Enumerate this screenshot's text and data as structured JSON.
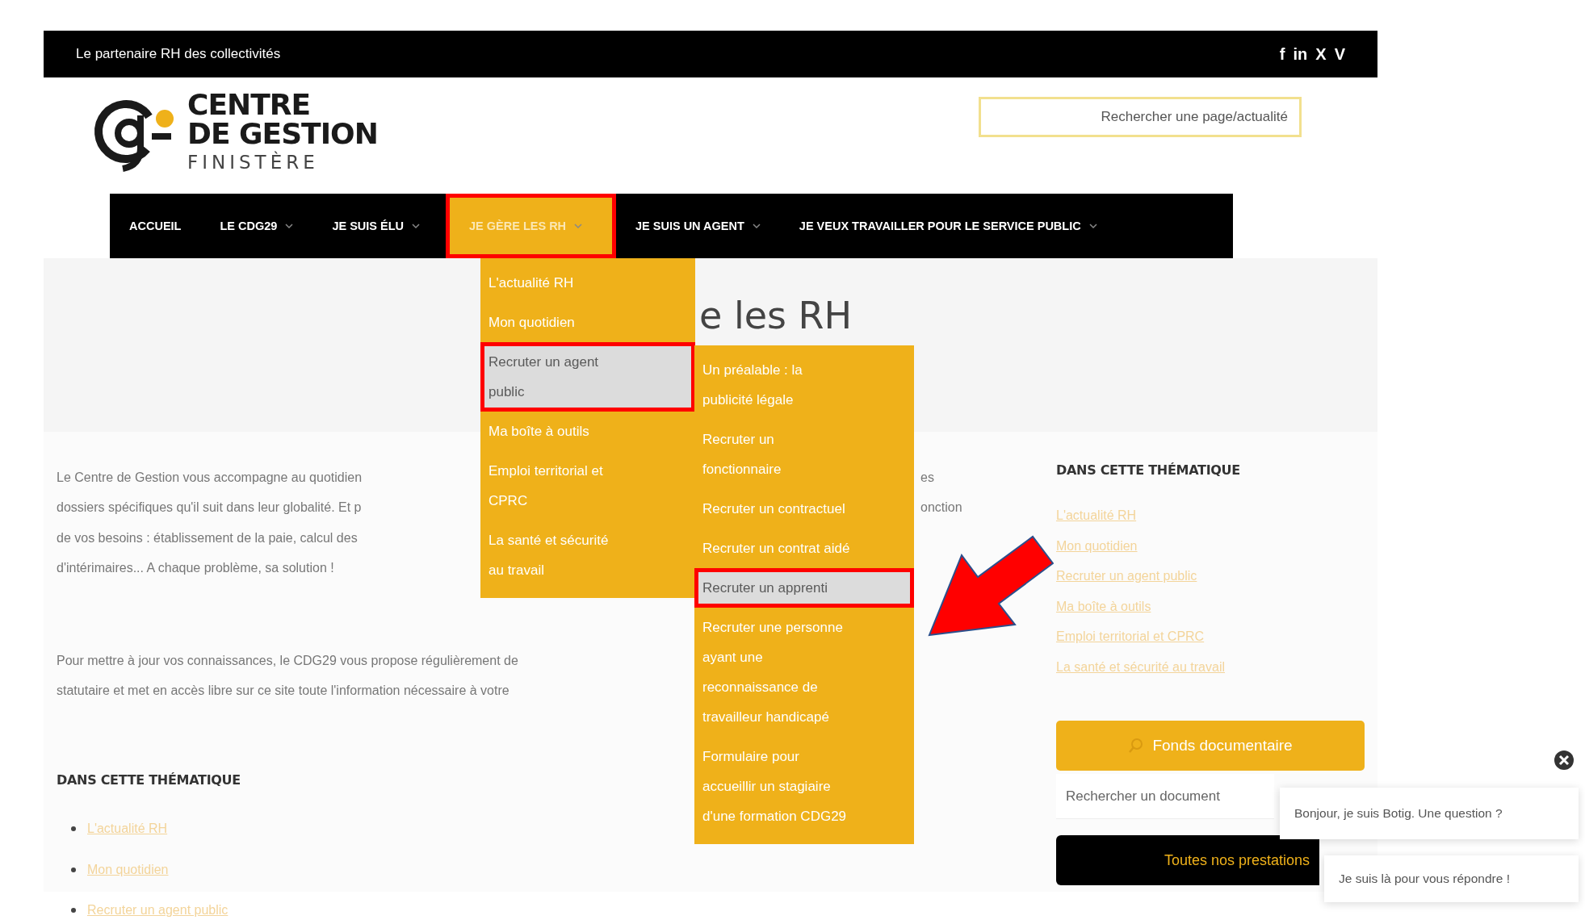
{
  "top_bar": {
    "tagline": "Le partenaire RH des collectivités",
    "social_links": [
      "f",
      "in",
      "X",
      "V"
    ]
  },
  "logo": {
    "line_1": "CENTRE",
    "line_2": "DE GESTION",
    "line_3": "FINISTÈRE"
  },
  "search": {
    "placeholder": "Rechercher une page/actualité"
  },
  "nav": [
    {
      "label": "ACCUEIL",
      "has_submenu": false,
      "selected": false,
      "highlighted": false
    },
    {
      "label": "LE CDG29",
      "has_submenu": true,
      "selected": false,
      "highlighted": false
    },
    {
      "label": "JE SUIS ÉLU",
      "has_submenu": true,
      "selected": false,
      "highlighted": false
    },
    {
      "label": "JE GÈRE LES RH",
      "has_submenu": true,
      "selected": true,
      "highlighted": true
    },
    {
      "label": "JE SUIS UN AGENT",
      "has_submenu": true,
      "selected": false,
      "highlighted": false
    },
    {
      "label": "JE VEUX TRAVAILLER POUR LE SERVICE PUBLIC",
      "has_submenu": true,
      "selected": false,
      "highlighted": false
    }
  ],
  "page_title": "e les RH",
  "intro_lines": [
    {
      "left": "Le Centre de Gestion vous accompagne au quotidien",
      "right": "es"
    },
    {
      "left": "dossiers spécifiques qu'il suit dans leur globalité. Et p",
      "right": "onction"
    },
    {
      "left": "de vos besoins : établissement de la paie, calcul des"
    },
    {
      "left": "d'intérimaires... A chaque problème, sa solution !"
    }
  ],
  "update_lines": [
    {
      "left": "Pour mettre à jour vos connaissances, le CDG29 vous propose régulièrement de"
    },
    {
      "left": "statutaire et met en accès libre sur ce site toute l'information nécessaire à votre"
    }
  ],
  "themes_section": {
    "heading": "DANS CETTE THÉMATIQUE",
    "links": [
      "L'actualité RH",
      "Mon quotidien",
      "Recruter un agent public"
    ]
  },
  "sidebar": {
    "heading": "DANS CETTE THÉMATIQUE",
    "links": [
      "L'actualité RH",
      "Mon quotidien",
      "Recruter un agent public",
      "Ma boîte à outils",
      "Emploi territorial et CPRC",
      "La santé et sécurité au travail"
    ],
    "docs_button": "Fonds documentaire",
    "doc_search": {
      "placeholder": "Rechercher un document"
    },
    "services_button": "Toutes nos prestations"
  },
  "submenu": [
    {
      "label": "L'actualité RH",
      "selected": false,
      "highlighted": false
    },
    {
      "label": "Mon quotidien",
      "selected": false,
      "highlighted": false
    },
    {
      "label": "Recruter un agent\npublic",
      "selected": true,
      "highlighted": true
    },
    {
      "label": "Ma boîte à outils",
      "selected": false,
      "highlighted": false
    },
    {
      "label": "Emploi territorial et\nCPRC",
      "selected": false,
      "highlighted": false
    },
    {
      "label": "La santé et sécurité\nau travail",
      "selected": false,
      "highlighted": false
    }
  ],
  "subsubmenu": [
    {
      "label": "Un préalable : la\npublicité légale",
      "selected": false,
      "highlighted": false
    },
    {
      "label": "Recruter un\nfonctionnaire",
      "selected": false,
      "highlighted": false
    },
    {
      "label": "Recruter un contractuel",
      "selected": false,
      "highlighted": false
    },
    {
      "label": "Recruter un contrat aidé",
      "selected": false,
      "highlighted": false
    },
    {
      "label": "Recruter un apprenti",
      "selected": true,
      "highlighted": true
    },
    {
      "label": "Recruter une personne\nayant une\nreconnaissance de\ntravailleur handicapé",
      "selected": false,
      "highlighted": false
    },
    {
      "label": "Formulaire pour\naccueillir un stagiaire\nd'une formation CDG29",
      "selected": false,
      "highlighted": false
    }
  ],
  "chat": {
    "messages": [
      "Bonjour, je suis Botig. Une question ?",
      "Je suis là pour vous répondre !"
    ]
  },
  "pointer_arrow": true
}
